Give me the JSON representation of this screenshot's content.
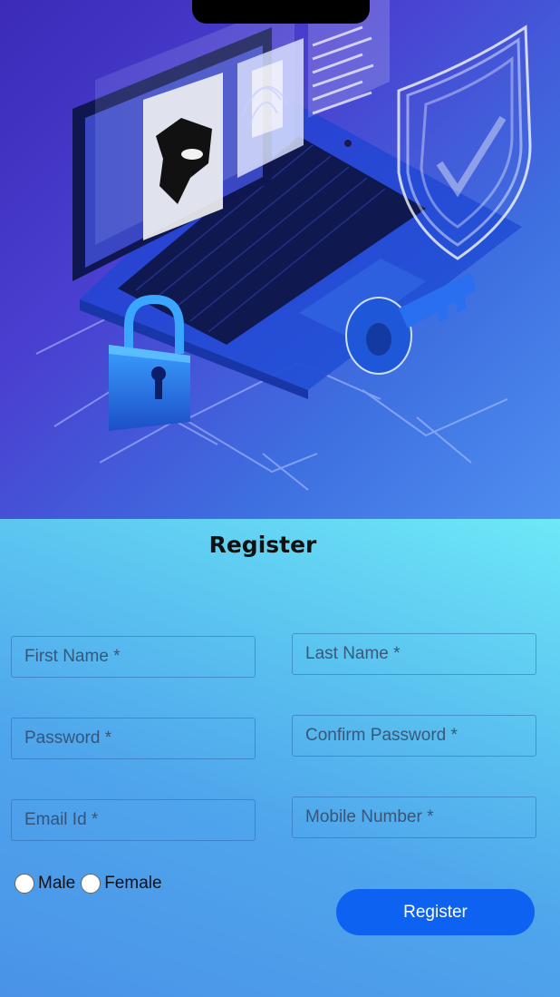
{
  "form": {
    "title": "Register",
    "first_name_placeholder": "First Name *",
    "last_name_placeholder": "Last Name *",
    "password_placeholder": "Password *",
    "confirm_password_placeholder": "Confirm Password *",
    "email_placeholder": "Email Id *",
    "mobile_placeholder": "Mobile Number *",
    "gender_options": [
      "Male",
      "Female"
    ],
    "register_button": "Register"
  },
  "colors": {
    "button": "#0d62f2",
    "hero_primary": "#4a3fd0",
    "form_gradient_top": "#6ee8f8"
  },
  "icons": {
    "hero": [
      "laptop-icon",
      "padlock-icon",
      "key-icon",
      "shield-check-icon",
      "fingerprint-icon",
      "mask-icon"
    ]
  }
}
